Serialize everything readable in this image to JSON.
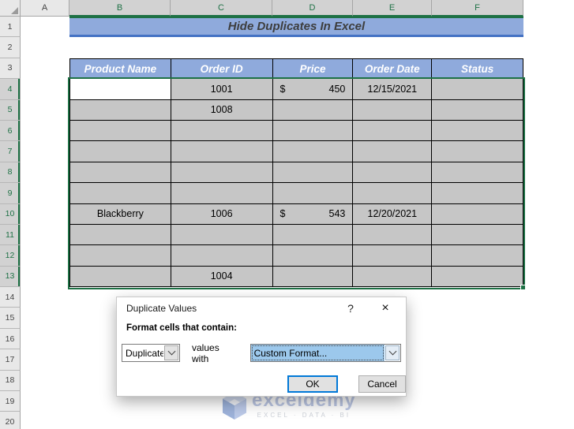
{
  "banner": {
    "title": "Hide Duplicates In Excel"
  },
  "sheet": {
    "columns": [
      {
        "label": "A",
        "selected": false
      },
      {
        "label": "B",
        "selected": true
      },
      {
        "label": "C",
        "selected": true
      },
      {
        "label": "D",
        "selected": true
      },
      {
        "label": "E",
        "selected": true
      },
      {
        "label": "F",
        "selected": true
      }
    ],
    "rows": [
      {
        "label": "1",
        "selected": false
      },
      {
        "label": "2",
        "selected": false
      },
      {
        "label": "3",
        "selected": false
      },
      {
        "label": "4",
        "selected": true
      },
      {
        "label": "5",
        "selected": true
      },
      {
        "label": "6",
        "selected": true
      },
      {
        "label": "7",
        "selected": true
      },
      {
        "label": "8",
        "selected": true
      },
      {
        "label": "9",
        "selected": true
      },
      {
        "label": "10",
        "selected": true
      },
      {
        "label": "11",
        "selected": true
      },
      {
        "label": "12",
        "selected": true
      },
      {
        "label": "13",
        "selected": true
      },
      {
        "label": "14",
        "selected": false
      },
      {
        "label": "15",
        "selected": false
      },
      {
        "label": "16",
        "selected": false
      },
      {
        "label": "17",
        "selected": false
      },
      {
        "label": "18",
        "selected": false
      },
      {
        "label": "19",
        "selected": false
      },
      {
        "label": "20",
        "selected": false
      }
    ]
  },
  "table": {
    "headers": [
      "Product Name",
      "Order ID",
      "Price",
      "Order Date",
      "Status"
    ],
    "rows": [
      {
        "product": "",
        "order_id": "1001",
        "currency": "$",
        "price": "450",
        "order_date": "12/15/2021",
        "status": "",
        "active_cell": true
      },
      {
        "product": "",
        "order_id": "1008",
        "currency": "",
        "price": "",
        "order_date": "",
        "status": "",
        "active_cell": false
      },
      {
        "product": "",
        "order_id": "",
        "currency": "",
        "price": "",
        "order_date": "",
        "status": "",
        "active_cell": false
      },
      {
        "product": "",
        "order_id": "",
        "currency": "",
        "price": "",
        "order_date": "",
        "status": "",
        "active_cell": false
      },
      {
        "product": "",
        "order_id": "",
        "currency": "",
        "price": "",
        "order_date": "",
        "status": "",
        "active_cell": false
      },
      {
        "product": "",
        "order_id": "",
        "currency": "",
        "price": "",
        "order_date": "",
        "status": "",
        "active_cell": false
      },
      {
        "product": "Blackberry",
        "order_id": "1006",
        "currency": "$",
        "price": "543",
        "order_date": "12/20/2021",
        "status": "",
        "active_cell": false
      },
      {
        "product": "",
        "order_id": "",
        "currency": "",
        "price": "",
        "order_date": "",
        "status": "",
        "active_cell": false
      },
      {
        "product": "",
        "order_id": "",
        "currency": "",
        "price": "",
        "order_date": "",
        "status": "",
        "active_cell": false
      },
      {
        "product": "",
        "order_id": "1004",
        "currency": "",
        "price": "",
        "order_date": "",
        "status": "",
        "active_cell": false
      }
    ]
  },
  "dialog": {
    "title": "Duplicate Values",
    "help_label": "?",
    "close_label": "×",
    "prompt": "Format cells that contain:",
    "type_select_value": "Duplicate",
    "connector_label": "values with",
    "format_select_value": "Custom Format...",
    "ok_label": "OK",
    "cancel_label": "Cancel"
  },
  "watermark": {
    "brand": "exceldemy",
    "tagline": "EXCEL · DATA · BI"
  },
  "colors": {
    "accent_blue": "#8faadc",
    "banner_underline": "#4472c4",
    "selection_green": "#1e7145",
    "cell_fill_gray": "#c6c6c6",
    "combo_focus_blue": "#9cc8ec",
    "ok_border_blue": "#0078d7"
  }
}
